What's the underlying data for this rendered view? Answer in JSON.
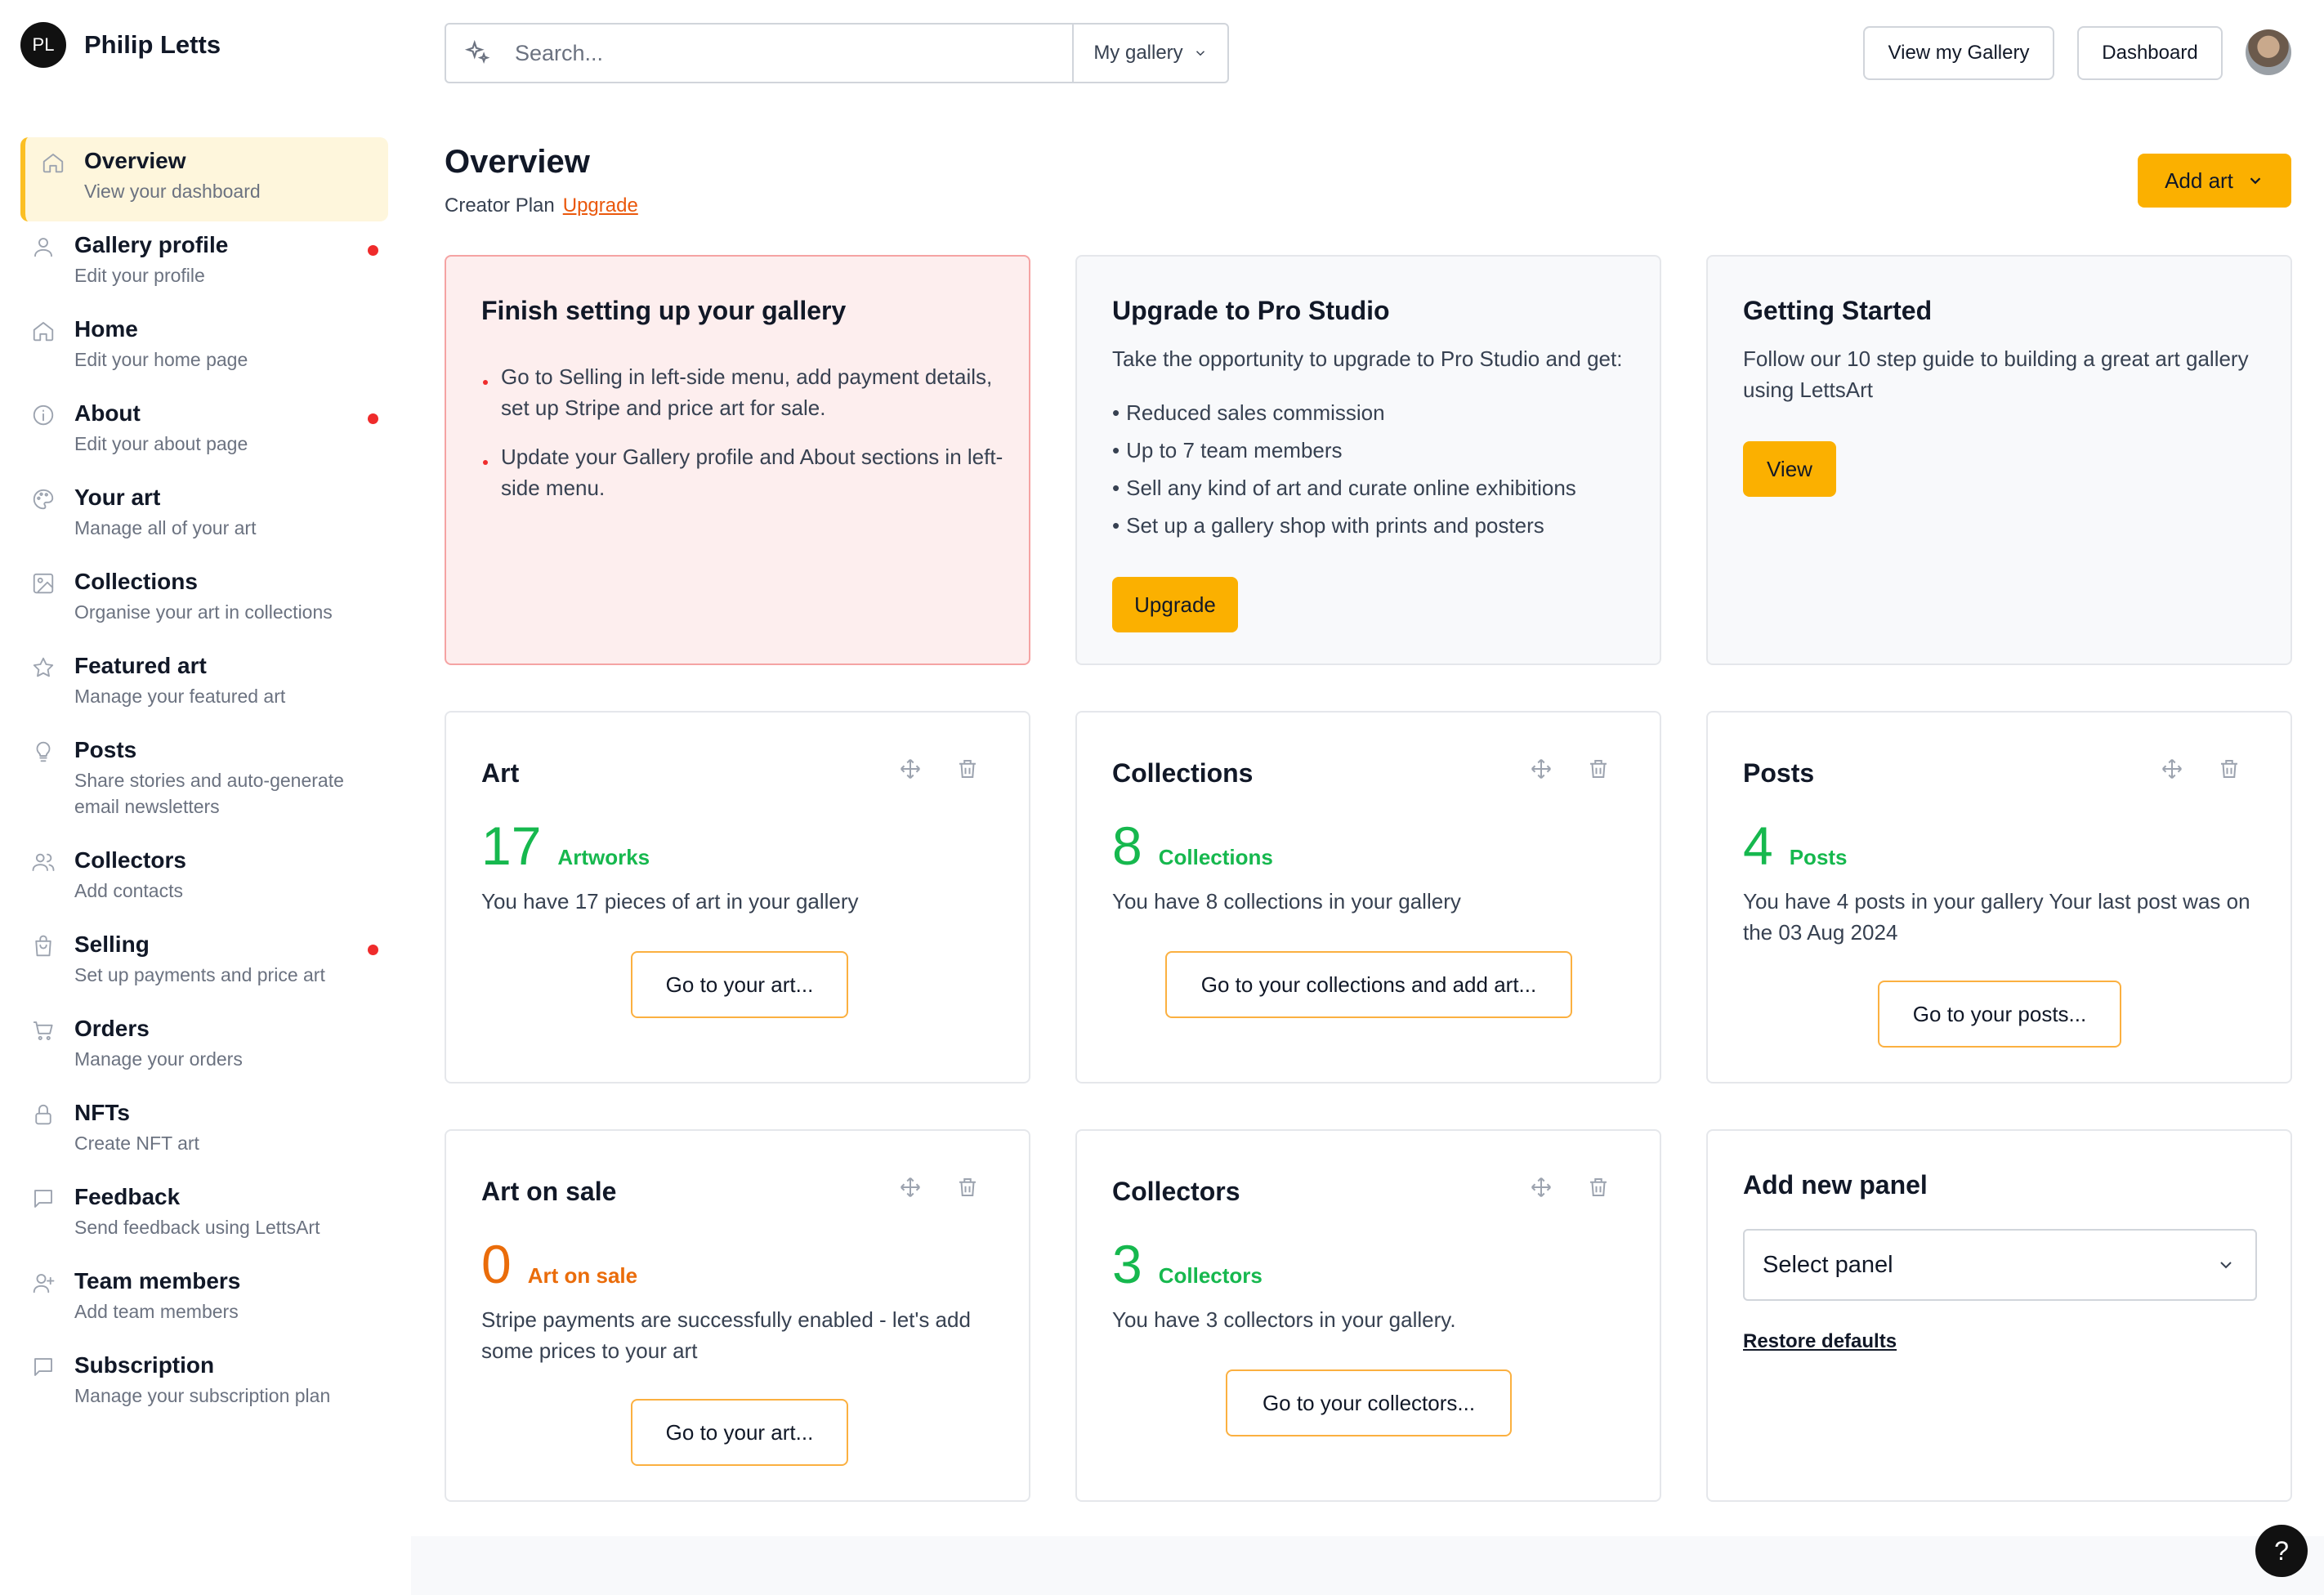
{
  "brand": {
    "initials": "PL",
    "name": "Philip Letts"
  },
  "search": {
    "placeholder": "Search...",
    "scope": "My gallery"
  },
  "header": {
    "view_gallery": "View my Gallery",
    "dashboard": "Dashboard"
  },
  "sidebar": {
    "items": [
      {
        "title": "Overview",
        "subtitle": "View your dashboard",
        "icon": "home-icon",
        "active": true,
        "dot": false
      },
      {
        "title": "Gallery profile",
        "subtitle": "Edit your profile",
        "icon": "user-icon",
        "dot": true
      },
      {
        "title": "Home",
        "subtitle": "Edit your home page",
        "icon": "home-icon",
        "dot": false
      },
      {
        "title": "About",
        "subtitle": "Edit your about page",
        "icon": "info-icon",
        "dot": true
      },
      {
        "title": "Your art",
        "subtitle": "Manage all of your art",
        "icon": "palette-icon",
        "dot": false
      },
      {
        "title": "Collections",
        "subtitle": "Organise your art in collections",
        "icon": "image-icon",
        "dot": false
      },
      {
        "title": "Featured art",
        "subtitle": "Manage your featured art",
        "icon": "star-icon",
        "dot": false
      },
      {
        "title": "Posts",
        "subtitle": "Share stories and auto-generate email newsletters",
        "icon": "lightbulb-icon",
        "dot": false
      },
      {
        "title": "Collectors",
        "subtitle": "Add contacts",
        "icon": "users-icon",
        "dot": false
      },
      {
        "title": "Selling",
        "subtitle": "Set up payments and price art",
        "icon": "bag-icon",
        "dot": true
      },
      {
        "title": "Orders",
        "subtitle": "Manage your orders",
        "icon": "cart-icon",
        "dot": false
      },
      {
        "title": "NFTs",
        "subtitle": "Create NFT art",
        "icon": "lock-icon",
        "dot": false
      },
      {
        "title": "Feedback",
        "subtitle": "Send feedback using LettsArt",
        "icon": "chat-icon",
        "dot": false
      },
      {
        "title": "Team members",
        "subtitle": "Add team members",
        "icon": "user-plus-icon",
        "dot": false
      },
      {
        "title": "Subscription",
        "subtitle": "Manage your subscription plan",
        "icon": "chat-icon",
        "dot": false
      }
    ]
  },
  "page": {
    "title": "Overview",
    "plan": "Creator Plan",
    "upgrade_link": "Upgrade",
    "add_art": "Add art"
  },
  "setup_card": {
    "title": "Finish setting up your gallery",
    "items": [
      "Go to Selling in left-side menu, add payment details, set up Stripe and price art for sale.",
      "Update your Gallery profile and About sections in left-side menu."
    ]
  },
  "upgrade_card": {
    "title": "Upgrade to Pro Studio",
    "intro": "Take the opportunity to upgrade to Pro Studio and get:",
    "benefits": [
      "Reduced sales commission",
      "Up to 7 team members",
      "Sell any kind of art and curate online exhibitions",
      "Set up a gallery shop with prints and posters"
    ],
    "button": "Upgrade"
  },
  "getting_started": {
    "title": "Getting Started",
    "text": "Follow our 10 step guide to building a great art gallery using LettsArt",
    "button": "View"
  },
  "art_card": {
    "title": "Art",
    "count": "17",
    "label": "Artworks",
    "text": "You have 17 pieces of art in your gallery",
    "button": "Go to your art..."
  },
  "collections_card": {
    "title": "Collections",
    "count": "8",
    "label": "Collections",
    "text": "You have 8 collections in your gallery",
    "button": "Go to your collections and add art..."
  },
  "posts_card": {
    "title": "Posts",
    "count": "4",
    "label": "Posts",
    "text": "You have 4 posts in your gallery Your last post was on the 03 Aug 2024",
    "button": "Go to your posts..."
  },
  "sale_card": {
    "title": "Art on sale",
    "count": "0",
    "label": "Art on sale",
    "text": "Stripe payments are successfully enabled - let's add some prices to your art",
    "button": "Go to your art..."
  },
  "collectors_card": {
    "title": "Collectors",
    "count": "3",
    "label": "Collectors",
    "text": "You have 3 collectors in your gallery.",
    "button": "Go to your collectors..."
  },
  "new_panel": {
    "title": "Add new panel",
    "select_value": "Select panel",
    "restore": "Restore defaults"
  },
  "help": {
    "label": "?"
  },
  "colors": {
    "accent": "#fbb000",
    "success": "#16b84e",
    "warning": "#ea6c0a",
    "alert": "#ef2b2b"
  }
}
